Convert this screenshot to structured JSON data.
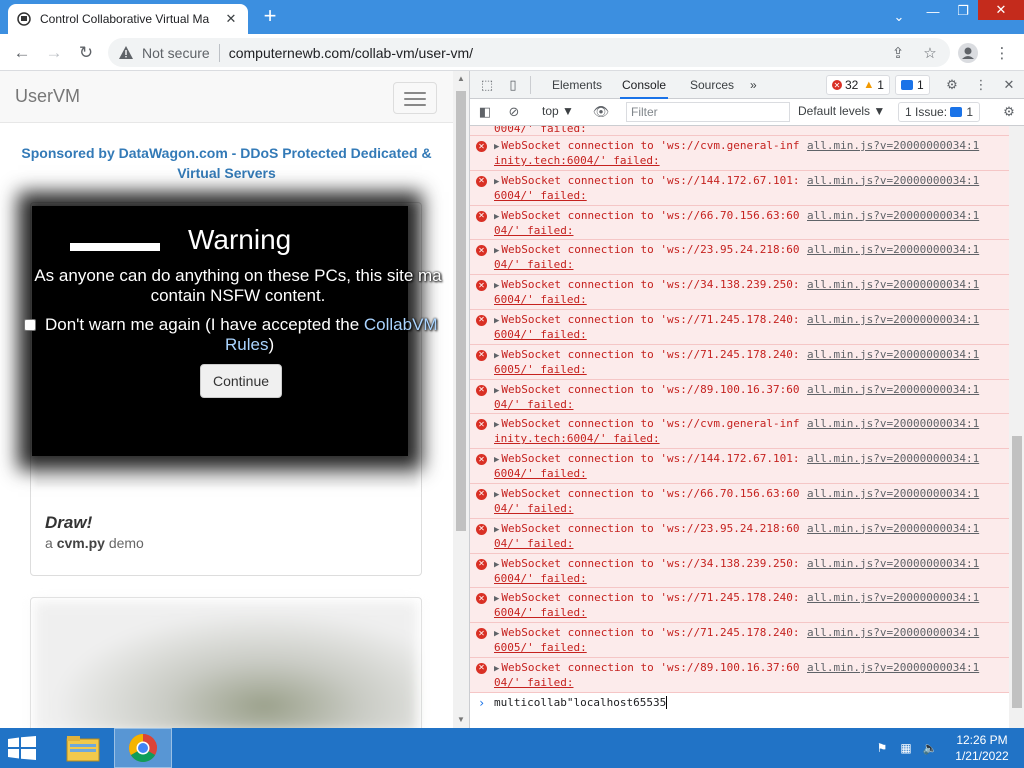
{
  "browser": {
    "tab_title": "Control Collaborative Virtual Ma",
    "address": {
      "security_label": "Not secure",
      "url": "computernewb.com/collab-vm/user-vm/"
    }
  },
  "page": {
    "brand": "UserVM",
    "sponsor_line1": "Sponsored by DataWagon.com - DDoS Protected Dedicated &",
    "sponsor_line2": "Virtual Servers",
    "card": {
      "title": "Draw!",
      "sub_prefix": "a ",
      "sub_bold": "cvm.py",
      "sub_suffix": " demo"
    },
    "warning": {
      "title": "Warning",
      "text_line1": "As anyone can do anything on these PCs, this site ma",
      "text_line2": "contain NSFW content.",
      "checkbox_label_prefix": "Don't warn me again (I have accepted the ",
      "checkbox_link1": "CollabVM",
      "checkbox_link2": "Rules",
      "checkbox_label_suffix": ")",
      "continue": "Continue"
    }
  },
  "devtools": {
    "tabs": [
      "Elements",
      "Console",
      "Sources"
    ],
    "active_tab": "Console",
    "more_tabs": "»",
    "error_count": "32",
    "warning_count": "1",
    "message_count": "1",
    "context": "top ▼",
    "filter_placeholder": "Filter",
    "levels": "Default levels ▼",
    "issues": "1 Issue:",
    "issues_count": "1",
    "partial_top": "0004/' failed:",
    "errors": [
      {
        "line1": "WebSocket connection to 'ws://cvm.general-inf",
        "line2": "inity.tech:6004/' failed:",
        "src": "all.min.js?v=20000000034:1"
      },
      {
        "line1": "WebSocket connection to 'ws://144.172.67.101:",
        "line2": "6004/' failed:",
        "src": "all.min.js?v=20000000034:1"
      },
      {
        "line1": "WebSocket connection to 'ws://66.70.156.63:60",
        "line2": "04/' failed:",
        "src": "all.min.js?v=20000000034:1"
      },
      {
        "line1": "WebSocket connection to 'ws://23.95.24.218:60",
        "line2": "04/' failed:",
        "src": "all.min.js?v=20000000034:1"
      },
      {
        "line1": "WebSocket connection to 'ws://34.138.239.250:",
        "line2": "6004/' failed:",
        "src": "all.min.js?v=20000000034:1"
      },
      {
        "line1": "WebSocket connection to 'ws://71.245.178.240:",
        "line2": "6004/' failed:",
        "src": "all.min.js?v=20000000034:1"
      },
      {
        "line1": "WebSocket connection to 'ws://71.245.178.240:",
        "line2": "6005/' failed:",
        "src": "all.min.js?v=20000000034:1"
      },
      {
        "line1": "WebSocket connection to 'ws://89.100.16.37:60",
        "line2": "04/' failed:",
        "src": "all.min.js?v=20000000034:1"
      },
      {
        "line1": "WebSocket connection to 'ws://cvm.general-inf",
        "line2": "inity.tech:6004/' failed:",
        "src": "all.min.js?v=20000000034:1"
      },
      {
        "line1": "WebSocket connection to 'ws://144.172.67.101:",
        "line2": "6004/' failed:",
        "src": "all.min.js?v=20000000034:1"
      },
      {
        "line1": "WebSocket connection to 'ws://66.70.156.63:60",
        "line2": "04/' failed:",
        "src": "all.min.js?v=20000000034:1"
      },
      {
        "line1": "WebSocket connection to 'ws://23.95.24.218:60",
        "line2": "04/' failed:",
        "src": "all.min.js?v=20000000034:1"
      },
      {
        "line1": "WebSocket connection to 'ws://34.138.239.250:",
        "line2": "6004/' failed:",
        "src": "all.min.js?v=20000000034:1"
      },
      {
        "line1": "WebSocket connection to 'ws://71.245.178.240:",
        "line2": "6004/' failed:",
        "src": "all.min.js?v=20000000034:1"
      },
      {
        "line1": "WebSocket connection to 'ws://71.245.178.240:",
        "line2": "6005/' failed:",
        "src": "all.min.js?v=20000000034:1"
      },
      {
        "line1": "WebSocket connection to 'ws://89.100.16.37:60",
        "line2": "04/' failed:",
        "src": "all.min.js?v=20000000034:1"
      }
    ],
    "prompt_input": "multicollab\"localhost65535"
  },
  "taskbar": {
    "time": "12:26 PM",
    "date": "1/21/2022"
  },
  "colors": {
    "taskbar": "#2173c6",
    "tabstrip": "#3c8fe0",
    "error_text": "#c5221f",
    "error_bg": "#fcebeb",
    "link": "#337ab7"
  }
}
